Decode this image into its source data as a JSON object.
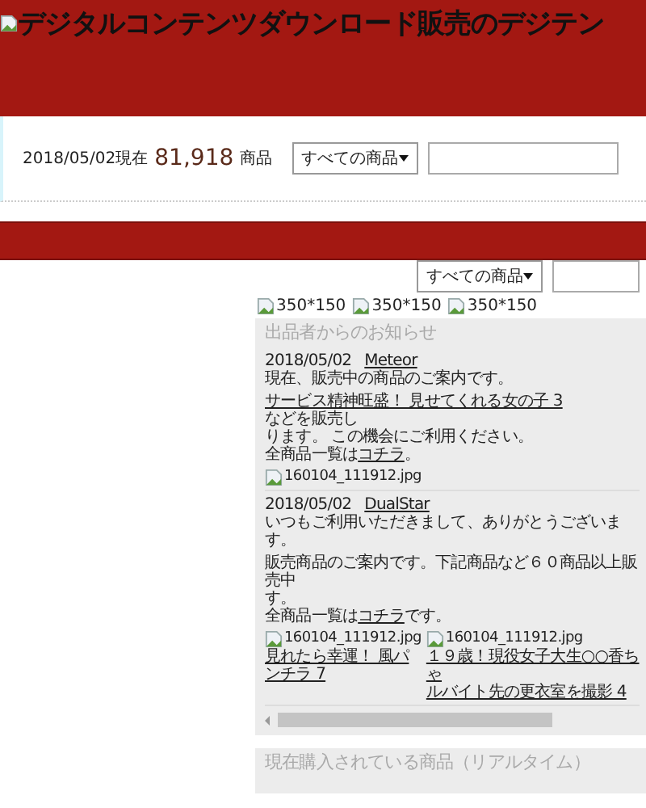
{
  "header": {
    "logo_alt": "デジタルコンテンツダウンロード販売のデジテン"
  },
  "search_bar": {
    "date_label": "2018/05/02現在",
    "count": "81,918",
    "count_unit": "商品",
    "category": "すべての商品"
  },
  "right_search": {
    "category": "すべての商品"
  },
  "banners": [
    {
      "alt": "350*150"
    },
    {
      "alt": "350*150"
    },
    {
      "alt": "350*150"
    }
  ],
  "notices": {
    "title": "出品者からのお知らせ",
    "posts": [
      {
        "date": "2018/05/02",
        "author": "Meteor",
        "body": [
          {
            "kind": "para",
            "lines": [
              [
                {
                  "text": "現在、販売中の商品のご案内です。",
                  "kind": "text"
                }
              ]
            ]
          },
          {
            "kind": "para",
            "lines": [
              [
                {
                  "text": "サービス精神旺盛！ 見せてくれる女の子 3",
                  "kind": "link"
                },
                {
                  "text": "などを販売し",
                  "kind": "text"
                }
              ],
              [
                {
                  "text": "ります。 この機会にご利用ください。",
                  "kind": "text"
                }
              ],
              [
                {
                  "text": "全商品一覧は",
                  "kind": "text"
                },
                {
                  "text": "コチラ",
                  "kind": "link"
                },
                {
                  "text": "。",
                  "kind": "text"
                }
              ]
            ]
          },
          {
            "kind": "images",
            "images": [
              {
                "alt": "160104_111912.jpg"
              }
            ]
          }
        ]
      },
      {
        "date": "2018/05/02",
        "author": "DualStar",
        "body": [
          {
            "kind": "para",
            "lines": [
              [
                {
                  "text": "いつもご利用いただきまして、ありがとうございます。",
                  "kind": "text"
                }
              ]
            ]
          },
          {
            "kind": "para",
            "lines": [
              [
                {
                  "text": "販売商品のご案内です。下記商品など６０商品以上販売中",
                  "kind": "text"
                }
              ],
              [
                {
                  "text": "す。",
                  "kind": "text"
                }
              ],
              [
                {
                  "text": "全商品一覧は",
                  "kind": "text"
                },
                {
                  "text": "コチラ",
                  "kind": "link"
                },
                {
                  "text": "です。",
                  "kind": "text"
                }
              ]
            ]
          },
          {
            "kind": "images",
            "images": [
              {
                "alt": "160104_111912.jpg",
                "caption": [
                  "見れたら幸運！ 風パ",
                  "ンチラ 7"
                ]
              },
              {
                "alt": "160104_111912.jpg",
                "caption": [
                  "１９歳！現役女子大生○○香ちゃ",
                  "ルバイト先の更衣室を撮影 4"
                ]
              }
            ]
          }
        ]
      }
    ]
  },
  "realtime": {
    "title": "現在購入されている商品（リアルタイム）"
  }
}
